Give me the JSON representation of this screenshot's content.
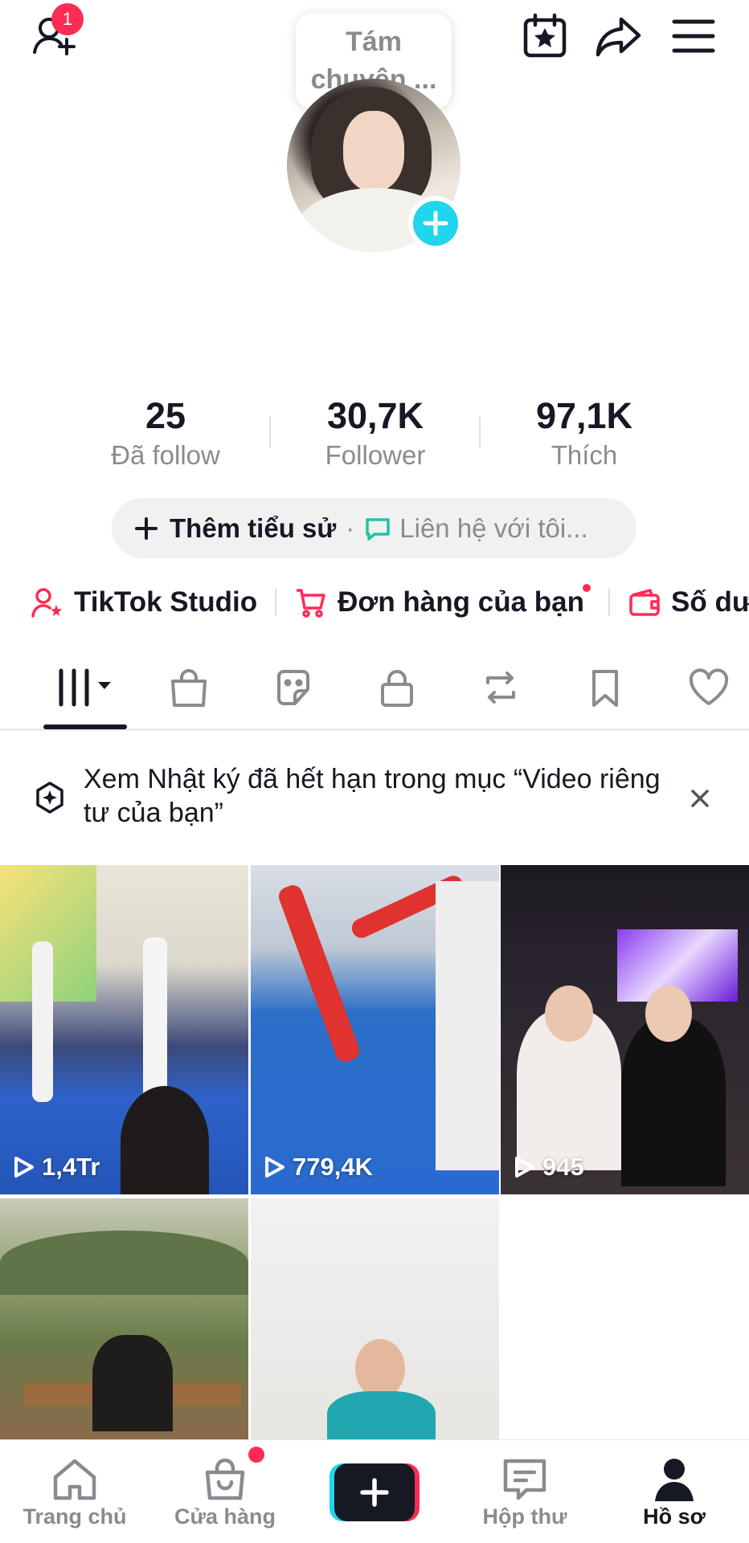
{
  "header": {
    "add_friend_badge": "1",
    "status_bubble": "Tám chuyện ..."
  },
  "stats": [
    {
      "value": "25",
      "label": "Đã follow"
    },
    {
      "value": "30,7K",
      "label": "Follower"
    },
    {
      "value": "97,1K",
      "label": "Thích"
    }
  ],
  "bio": {
    "add_bio": "Thêm tiểu sử",
    "separator": "·",
    "contact_placeholder": "Liên hệ với tôi..."
  },
  "links": {
    "studio": "TikTok Studio",
    "orders": "Đơn hàng của bạn",
    "balance": "Số dư"
  },
  "notice": {
    "text": "Xem Nhật ký đã hết hạn trong mục “Video riêng tư của bạn”"
  },
  "videos": [
    {
      "views": "1,4Tr"
    },
    {
      "views": "779,4K"
    },
    {
      "views": "945"
    },
    {
      "views": ""
    },
    {
      "views": ""
    }
  ],
  "bottom_nav": {
    "home": "Trang chủ",
    "shop": "Cửa hàng",
    "inbox": "Hộp thư",
    "profile": "Hồ sơ"
  },
  "colors": {
    "accent_red": "#fe2c55",
    "accent_cyan": "#20d5ec",
    "text_primary": "#161823",
    "text_secondary": "#8a8b91"
  },
  "icons": [
    "add-friend-icon",
    "calendar-star-icon",
    "share-icon",
    "menu-icon",
    "plus-icon",
    "chat-bubble-icon",
    "person-star-icon",
    "cart-icon",
    "wallet-icon",
    "grid-icon",
    "bag-icon",
    "sticker-icon",
    "lock-icon",
    "repost-icon",
    "bookmark-icon",
    "heart-icon",
    "sparkle-icon",
    "close-icon",
    "play-icon",
    "home-icon",
    "shop-icon",
    "inbox-icon",
    "profile-icon"
  ]
}
